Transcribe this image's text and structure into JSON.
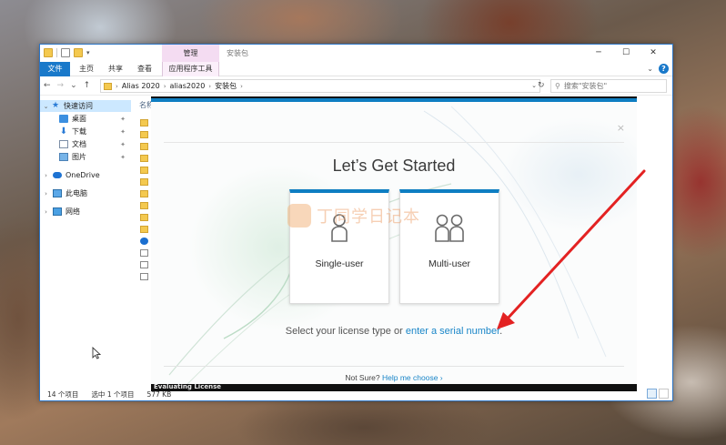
{
  "explorer": {
    "title": "安装包",
    "manage_tab": "管理",
    "ribbon": {
      "file": "文件",
      "home": "主页",
      "share": "共享",
      "view": "查看",
      "app_tools": "应用程序工具"
    },
    "controls": {
      "minimize": "─",
      "maximize": "☐",
      "close": "✕"
    },
    "breadcrumbs": [
      "Alias 2020",
      "alias2020",
      "安装包"
    ],
    "search_placeholder": "搜索\"安装包\"",
    "column_header": "名称",
    "nav": {
      "quick_access": "快速访问",
      "desktop": "桌面",
      "downloads": "下载",
      "documents": "文档",
      "pictures": "图片",
      "onedrive": "OneDrive",
      "this_pc": "此电脑",
      "network": "网络"
    },
    "status": {
      "item_count": "14 个项目",
      "selected": "选中 1 个项目",
      "size": "577 KB"
    }
  },
  "installer": {
    "status_text": "Evaluating License"
  },
  "dialog": {
    "title": "Let’s Get Started",
    "close": "×",
    "options": [
      {
        "label": "Single-user"
      },
      {
        "label": "Multi-user"
      }
    ],
    "prompt_prefix": "Select your license type or ",
    "prompt_link": "enter a serial number",
    "prompt_suffix": ".",
    "not_sure": "Not Sure?",
    "help_link": "Help me choose",
    "help_chevron": "›",
    "watermark_text": "丁同学日记本"
  },
  "colors": {
    "accent": "#0e7ec2",
    "link": "#1a86c8",
    "ribbon_file": "#1979ca",
    "manage_tab": "#f4dcf2",
    "annotation": "#e32222"
  }
}
